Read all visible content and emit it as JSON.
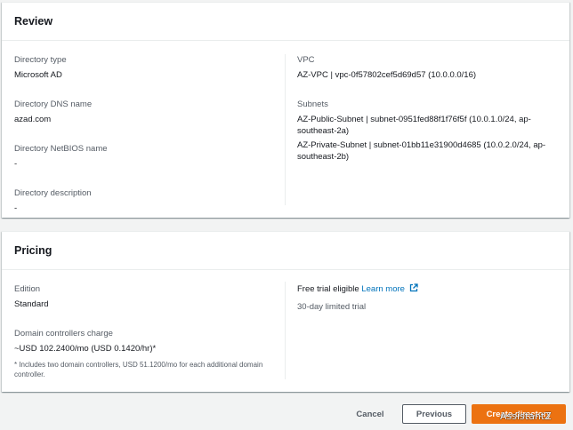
{
  "review": {
    "title": "Review",
    "directory_type_label": "Directory type",
    "directory_type_value": "Microsoft AD",
    "dns_name_label": "Directory DNS name",
    "dns_name_value": "azad.com",
    "netbios_label": "Directory NetBIOS name",
    "netbios_value": "-",
    "description_label": "Directory description",
    "description_value": "-",
    "vpc_label": "VPC",
    "vpc_value": "AZ-VPC | vpc-0f57802cef5d69d57 (10.0.0.0/16)",
    "subnets_label": "Subnets",
    "subnets": [
      "AZ-Public-Subnet | subnet-0951fed88f1f76f5f (10.0.1.0/24, ap-southeast-2a)",
      "AZ-Private-Subnet | subnet-01bb11e31900d4685 (10.0.2.0/24, ap-southeast-2b)"
    ]
  },
  "pricing": {
    "title": "Pricing",
    "edition_label": "Edition",
    "edition_value": "Standard",
    "dc_charge_label": "Domain controllers charge",
    "dc_charge_value": "~USD 102.2400/mo (USD 0.1420/hr)*",
    "dc_charge_note": "* Includes two domain controllers, USD 51.1200/mo for each additional domain controller.",
    "free_trial_label": "Free trial eligible",
    "learn_more": "Learn more",
    "trial_text": "30-day limited trial"
  },
  "footer": {
    "cancel": "Cancel",
    "previous": "Previous",
    "create": "Create directory"
  },
  "watermark": "AssistantZ",
  "icons": {
    "external": "external-link-icon"
  },
  "colors": {
    "accent": "#ec7211",
    "link": "#0073bb"
  }
}
